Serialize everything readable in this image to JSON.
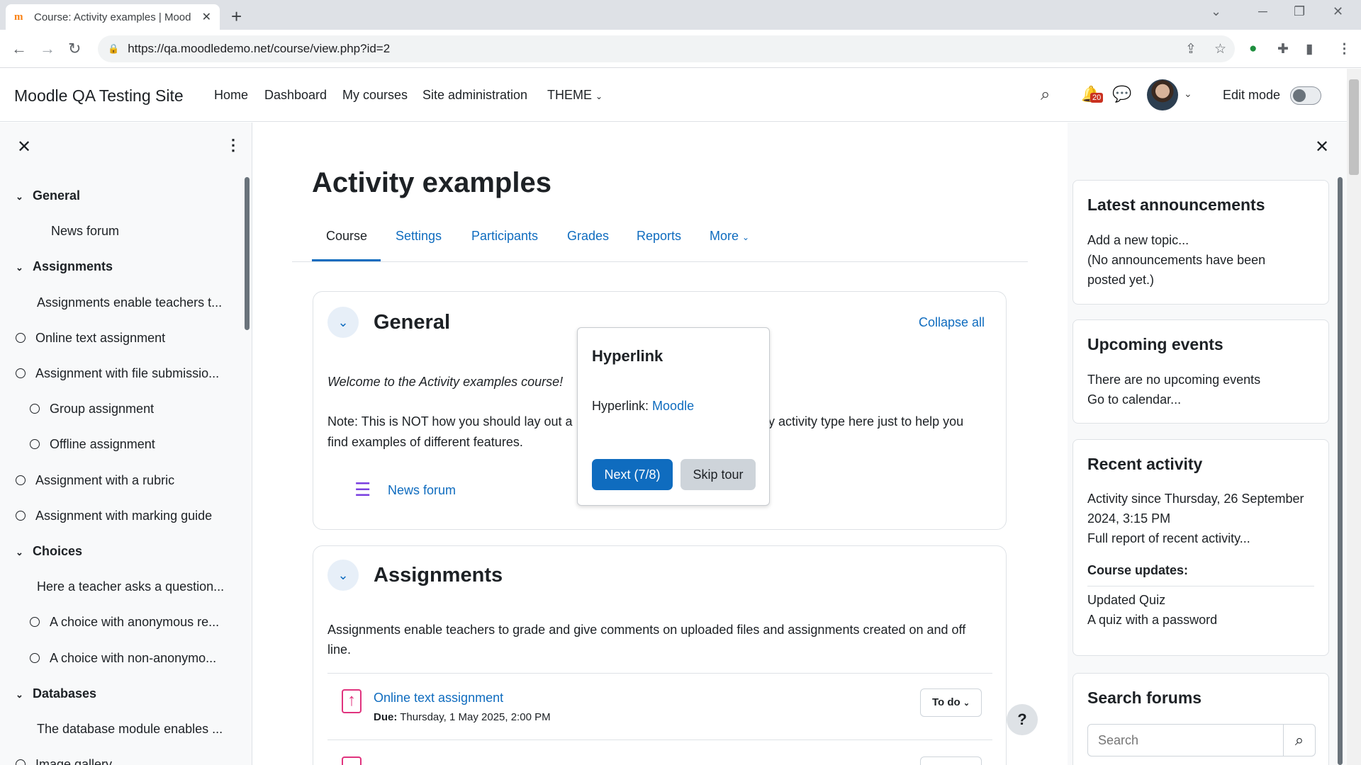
{
  "browser": {
    "tab_title": "Course: Activity examples | Mood",
    "favicon": "m",
    "url": "https://qa.moodledemo.net/course/view.php?id=2"
  },
  "nav": {
    "site_name": "Moodle QA Testing Site",
    "links": [
      "Home",
      "Dashboard",
      "My courses",
      "Site administration",
      "THEME"
    ],
    "notifications_count": "20",
    "edit_mode_label": "Edit mode"
  },
  "course_index": {
    "items": [
      {
        "label": "General",
        "type": "section"
      },
      {
        "label": "News forum",
        "type": "activity"
      },
      {
        "label": "Assignments",
        "type": "section"
      },
      {
        "label": "Assignments enable teachers t...",
        "type": "label"
      },
      {
        "label": "Online text assignment",
        "type": "activity-circle"
      },
      {
        "label": "Assignment with file submissio...",
        "type": "activity-circle"
      },
      {
        "label": "Group assignment",
        "type": "activity-circle-indent"
      },
      {
        "label": "Offline assignment",
        "type": "activity-circle-indent"
      },
      {
        "label": "Assignment with a rubric",
        "type": "activity-circle"
      },
      {
        "label": "Assignment with marking guide",
        "type": "activity-circle"
      },
      {
        "label": "Choices",
        "type": "section"
      },
      {
        "label": "Here a teacher asks a question...",
        "type": "label"
      },
      {
        "label": "A choice with anonymous re...",
        "type": "activity-circle-indent"
      },
      {
        "label": "A choice with non-anonymo...",
        "type": "activity-circle-indent"
      },
      {
        "label": "Databases",
        "type": "section"
      },
      {
        "label": "The database module enables ...",
        "type": "label"
      },
      {
        "label": "Image gallery",
        "type": "activity-circle"
      }
    ]
  },
  "course": {
    "title": "Activity examples",
    "tabs": [
      "Course",
      "Settings",
      "Participants",
      "Grades",
      "Reports",
      "More"
    ],
    "collapse_all": "Collapse all",
    "general": {
      "title": "General",
      "welcome": "Welcome to the Activity examples course!",
      "note_line1_a": "Note: This is NOT how you should lay out a",
      "note_line1_b": "y activity type here just to help you",
      "note_line2": "find examples of different features.",
      "forum_link": "News forum"
    },
    "assignments": {
      "title": "Assignments",
      "desc_line1": "Assignments enable teachers to grade and give comments on uploaded files and assignments created on and off",
      "desc_line2": "line.",
      "activity_name": "Online text assignment",
      "due_label": "Due:",
      "due_value": "Thursday, 1 May 2025, 2:00 PM",
      "todo_label": "To do"
    }
  },
  "tour": {
    "title": "Hyperlink",
    "body_prefix": "Hyperlink:",
    "body_link": "Moodle",
    "next": "Next (7/8)",
    "skip": "Skip tour"
  },
  "blocks": {
    "announcements": {
      "title": "Latest announcements",
      "add_link": "Add a new topic...",
      "empty_line1": "(No announcements have been",
      "empty_line2": "posted yet.)"
    },
    "events": {
      "title": "Upcoming events",
      "empty": "There are no upcoming events",
      "calendar_link": "Go to calendar..."
    },
    "recent": {
      "title": "Recent activity",
      "since_line1": "Activity since Thursday, 26 September",
      "since_line2": "2024, 3:15 PM",
      "full_report": "Full report of recent activity...",
      "updates_heading": "Course updates:",
      "updated": "Updated Quiz",
      "quiz_link": "A quiz with a password"
    },
    "search": {
      "title": "Search forums",
      "placeholder": "Search"
    }
  },
  "help": "?",
  "colors": {
    "link": "#0f6cbf",
    "moodle_orange": "#f98012",
    "forum_purple": "#7a3fe0",
    "assign_pink": "#e0337e",
    "badge_red": "#ca3120"
  }
}
